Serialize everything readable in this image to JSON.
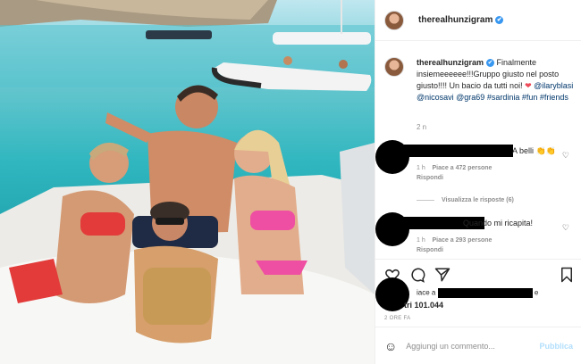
{
  "post": {
    "username": "therealhunzigram",
    "caption_user": "therealhunzigram",
    "caption_text": "Finalmente insiemeeeeee!!!Gruppo giusto nel posto giusto!!!! Un bacio da tutti noi!",
    "caption_heart": "❤",
    "mentions": "@ilaryblasi @nicosavi @gra69",
    "hashtags": "#sardinia #fun #friends",
    "time": "2 n"
  },
  "comments": [
    {
      "text": "A belli 👏👏",
      "age": "1 h",
      "likes": "Piace a 472 persone",
      "reply": "Rispondi"
    },
    {
      "text": "Quando mi ricapita!",
      "age": "1 h",
      "likes": "Piace a 293 persone",
      "reply": "Rispondi"
    }
  ],
  "view_replies": "Visualizza le risposte (6)",
  "likes": {
    "prefix": "iace a",
    "suffix": "e",
    "count": "tri 101.044"
  },
  "ago": "2 ORE FA",
  "add_comment": {
    "placeholder": "Aggiungi un commento...",
    "publish": "Pubblica"
  },
  "icons": [
    "verified-badge",
    "heart-icon",
    "comment-icon",
    "share-icon",
    "bookmark-icon",
    "emoji-icon"
  ],
  "colors": {
    "link": "#00376b",
    "verified": "#3897f0",
    "muted": "#8e8e8e",
    "publish_disabled": "#b2dffc"
  }
}
